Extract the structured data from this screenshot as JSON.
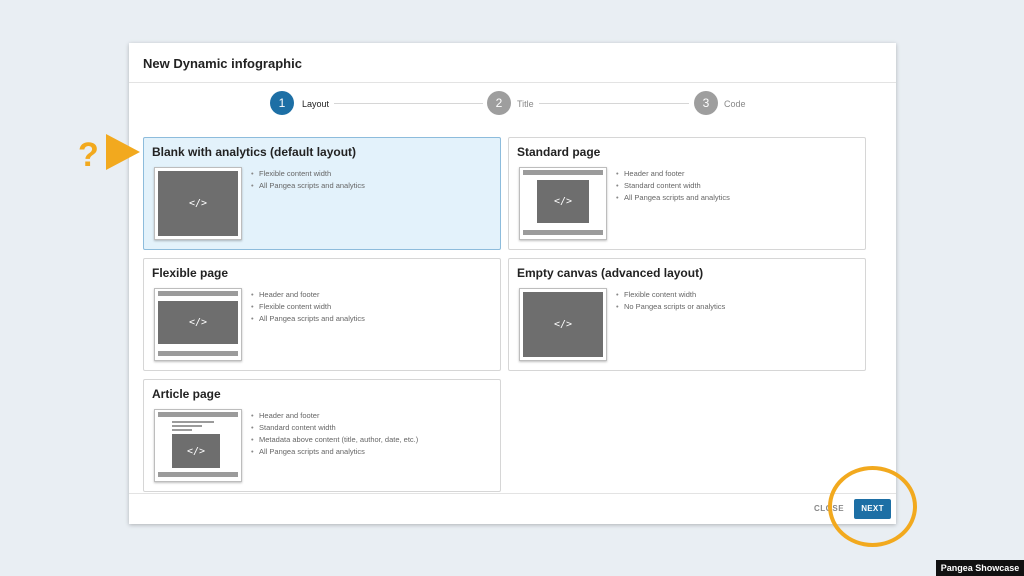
{
  "dialog": {
    "title": "New Dynamic infographic"
  },
  "stepper": {
    "steps": [
      {
        "number": "1",
        "label": "Layout"
      },
      {
        "number": "2",
        "label": "Title"
      },
      {
        "number": "3",
        "label": "Code"
      }
    ],
    "active_step": 1
  },
  "layouts": [
    {
      "title": "Blank with analytics (default layout)",
      "selected": true,
      "features": [
        "Flexible content width",
        "All Pangea scripts and analytics"
      ],
      "thumb_glyph": "</>"
    },
    {
      "title": "Standard page",
      "selected": false,
      "features": [
        "Header and footer",
        "Standard content width",
        "All Pangea scripts and analytics"
      ],
      "thumb_glyph": "</>"
    },
    {
      "title": "Flexible page",
      "selected": false,
      "features": [
        "Header and footer",
        "Flexible content width",
        "All Pangea scripts and analytics"
      ],
      "thumb_glyph": "</>"
    },
    {
      "title": "Empty canvas (advanced layout)",
      "selected": false,
      "features": [
        "Flexible content width",
        "No Pangea scripts or analytics"
      ],
      "thumb_glyph": "</>"
    },
    {
      "title": "Article page",
      "selected": false,
      "features": [
        "Header and footer",
        "Standard content width",
        "Metadata above content (title, author, date, etc.)",
        "All Pangea scripts and analytics"
      ],
      "thumb_glyph": "</>"
    }
  ],
  "footer": {
    "close_label": "CLOSE",
    "next_label": "NEXT"
  },
  "annotations": {
    "question_mark": "?",
    "brand": "Pangea Showcase"
  },
  "colors": {
    "accent": "#1d6fa5",
    "selected_bg": "#e3f2fb",
    "annotation": "#f2a91e",
    "background": "#e9eef3"
  }
}
